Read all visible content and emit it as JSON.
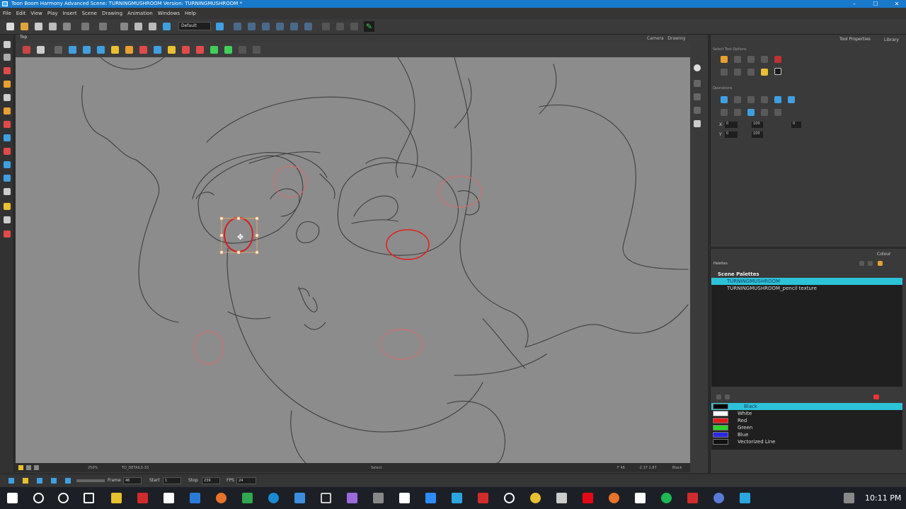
{
  "window": {
    "title": "Toon Boom Harmony Advanced Scene: TURNINGMUSHROOM Version: TURNINGMUSHROOM *",
    "minimize": "–",
    "maximize": "☐",
    "close": "✕"
  },
  "menu": [
    "File",
    "Edit",
    "View",
    "Play",
    "Insert",
    "Scene",
    "Drawing",
    "Animation",
    "Windows",
    "Help"
  ],
  "toolbar": {
    "workspace": "Default"
  },
  "view": {
    "tab": "Top",
    "tabs_right": [
      "Camera",
      "Drawing"
    ],
    "status_zoom": "250%",
    "status_drawing": "TD_DETAILS-33",
    "status_tool": "Select",
    "status_frame": "F 46",
    "status_coords": "-2.37 1.87",
    "status_colour": "Black"
  },
  "timeline": {
    "frame_label": "Frame",
    "frame": "46",
    "start_label": "Start",
    "start": "1",
    "stop_label": "Stop",
    "stop": "239",
    "fps_label": "FPS",
    "fps": "24"
  },
  "tool_properties": {
    "tabs": [
      "Tool Properties",
      "Library"
    ],
    "section_select": "Select Tool Options",
    "section_operations": "Operations",
    "x_label": "X",
    "x_value": "0",
    "y_label": "Y",
    "y_value": "0",
    "w_value": "100",
    "h_value": "100",
    "angle_value": "0"
  },
  "colour_panel": {
    "tab": "Colour",
    "palettes_label": "Palettes",
    "scene_palettes": "Scene Palettes",
    "palettes": [
      {
        "name": "TURNINGMUSHROOM",
        "selected": true
      },
      {
        "name": "TURNINGMUSHROOM_pencil texture",
        "selected": false
      }
    ],
    "swatches": [
      {
        "name": "Black",
        "color": "#000000",
        "selected": true
      },
      {
        "name": "White",
        "color": "#ffffff",
        "selected": false
      },
      {
        "name": "Red",
        "color": "#e21d1d",
        "selected": false
      },
      {
        "name": "Green",
        "color": "#2fd22f",
        "selected": false
      },
      {
        "name": "Blue",
        "color": "#2a2ae6",
        "selected": false
      },
      {
        "name": "Vectorized Line",
        "color": "#111111",
        "selected": false
      }
    ]
  },
  "taskbar": {
    "time": "10:11 PM"
  },
  "colors": {
    "accent": "#2cc3d9",
    "titlebar": "#1979ca",
    "canvas": "#8c8c8c",
    "selection": "#e33b2e"
  }
}
